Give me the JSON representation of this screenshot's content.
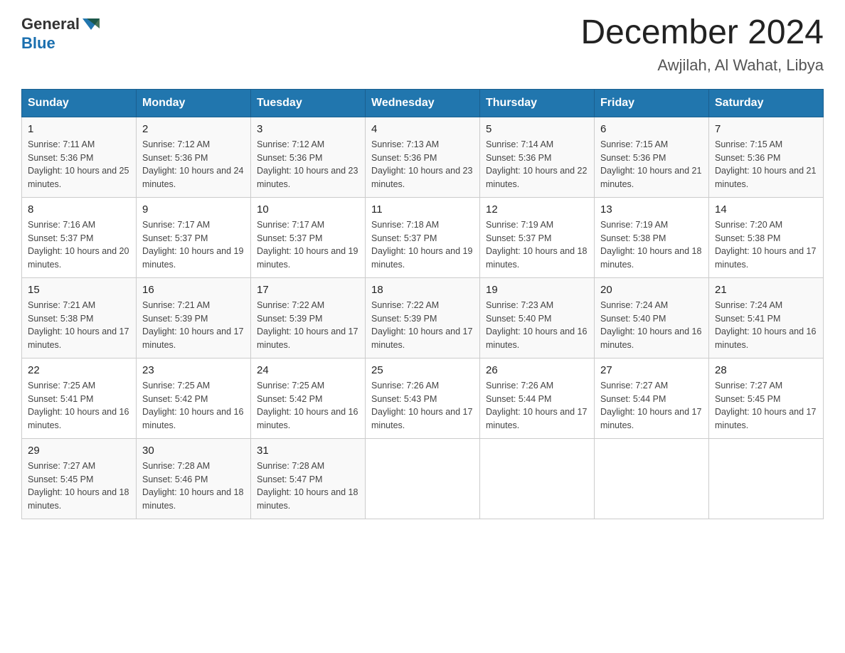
{
  "header": {
    "logo_general": "General",
    "logo_blue": "Blue",
    "month_title": "December 2024",
    "location": "Awjilah, Al Wahat, Libya"
  },
  "days_of_week": [
    "Sunday",
    "Monday",
    "Tuesday",
    "Wednesday",
    "Thursday",
    "Friday",
    "Saturday"
  ],
  "weeks": [
    [
      {
        "day": "1",
        "sunrise": "7:11 AM",
        "sunset": "5:36 PM",
        "daylight": "10 hours and 25 minutes."
      },
      {
        "day": "2",
        "sunrise": "7:12 AM",
        "sunset": "5:36 PM",
        "daylight": "10 hours and 24 minutes."
      },
      {
        "day": "3",
        "sunrise": "7:12 AM",
        "sunset": "5:36 PM",
        "daylight": "10 hours and 23 minutes."
      },
      {
        "day": "4",
        "sunrise": "7:13 AM",
        "sunset": "5:36 PM",
        "daylight": "10 hours and 23 minutes."
      },
      {
        "day": "5",
        "sunrise": "7:14 AM",
        "sunset": "5:36 PM",
        "daylight": "10 hours and 22 minutes."
      },
      {
        "day": "6",
        "sunrise": "7:15 AM",
        "sunset": "5:36 PM",
        "daylight": "10 hours and 21 minutes."
      },
      {
        "day": "7",
        "sunrise": "7:15 AM",
        "sunset": "5:36 PM",
        "daylight": "10 hours and 21 minutes."
      }
    ],
    [
      {
        "day": "8",
        "sunrise": "7:16 AM",
        "sunset": "5:37 PM",
        "daylight": "10 hours and 20 minutes."
      },
      {
        "day": "9",
        "sunrise": "7:17 AM",
        "sunset": "5:37 PM",
        "daylight": "10 hours and 19 minutes."
      },
      {
        "day": "10",
        "sunrise": "7:17 AM",
        "sunset": "5:37 PM",
        "daylight": "10 hours and 19 minutes."
      },
      {
        "day": "11",
        "sunrise": "7:18 AM",
        "sunset": "5:37 PM",
        "daylight": "10 hours and 19 minutes."
      },
      {
        "day": "12",
        "sunrise": "7:19 AM",
        "sunset": "5:37 PM",
        "daylight": "10 hours and 18 minutes."
      },
      {
        "day": "13",
        "sunrise": "7:19 AM",
        "sunset": "5:38 PM",
        "daylight": "10 hours and 18 minutes."
      },
      {
        "day": "14",
        "sunrise": "7:20 AM",
        "sunset": "5:38 PM",
        "daylight": "10 hours and 17 minutes."
      }
    ],
    [
      {
        "day": "15",
        "sunrise": "7:21 AM",
        "sunset": "5:38 PM",
        "daylight": "10 hours and 17 minutes."
      },
      {
        "day": "16",
        "sunrise": "7:21 AM",
        "sunset": "5:39 PM",
        "daylight": "10 hours and 17 minutes."
      },
      {
        "day": "17",
        "sunrise": "7:22 AM",
        "sunset": "5:39 PM",
        "daylight": "10 hours and 17 minutes."
      },
      {
        "day": "18",
        "sunrise": "7:22 AM",
        "sunset": "5:39 PM",
        "daylight": "10 hours and 17 minutes."
      },
      {
        "day": "19",
        "sunrise": "7:23 AM",
        "sunset": "5:40 PM",
        "daylight": "10 hours and 16 minutes."
      },
      {
        "day": "20",
        "sunrise": "7:24 AM",
        "sunset": "5:40 PM",
        "daylight": "10 hours and 16 minutes."
      },
      {
        "day": "21",
        "sunrise": "7:24 AM",
        "sunset": "5:41 PM",
        "daylight": "10 hours and 16 minutes."
      }
    ],
    [
      {
        "day": "22",
        "sunrise": "7:25 AM",
        "sunset": "5:41 PM",
        "daylight": "10 hours and 16 minutes."
      },
      {
        "day": "23",
        "sunrise": "7:25 AM",
        "sunset": "5:42 PM",
        "daylight": "10 hours and 16 minutes."
      },
      {
        "day": "24",
        "sunrise": "7:25 AM",
        "sunset": "5:42 PM",
        "daylight": "10 hours and 16 minutes."
      },
      {
        "day": "25",
        "sunrise": "7:26 AM",
        "sunset": "5:43 PM",
        "daylight": "10 hours and 17 minutes."
      },
      {
        "day": "26",
        "sunrise": "7:26 AM",
        "sunset": "5:44 PM",
        "daylight": "10 hours and 17 minutes."
      },
      {
        "day": "27",
        "sunrise": "7:27 AM",
        "sunset": "5:44 PM",
        "daylight": "10 hours and 17 minutes."
      },
      {
        "day": "28",
        "sunrise": "7:27 AM",
        "sunset": "5:45 PM",
        "daylight": "10 hours and 17 minutes."
      }
    ],
    [
      {
        "day": "29",
        "sunrise": "7:27 AM",
        "sunset": "5:45 PM",
        "daylight": "10 hours and 18 minutes."
      },
      {
        "day": "30",
        "sunrise": "7:28 AM",
        "sunset": "5:46 PM",
        "daylight": "10 hours and 18 minutes."
      },
      {
        "day": "31",
        "sunrise": "7:28 AM",
        "sunset": "5:47 PM",
        "daylight": "10 hours and 18 minutes."
      },
      null,
      null,
      null,
      null
    ]
  ]
}
